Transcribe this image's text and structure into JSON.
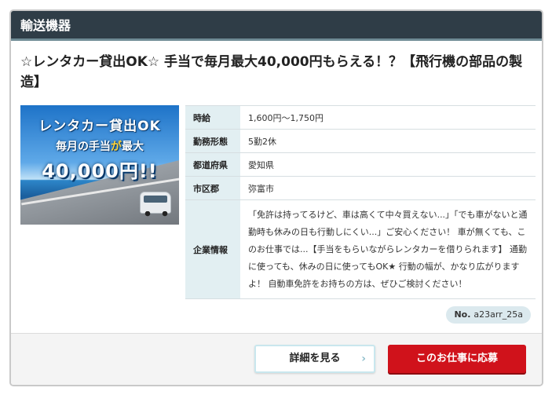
{
  "category": "輸送機器",
  "job": {
    "title": "☆レンタカー貸出OK☆ 手当で毎月最大40,000円もらえる！？【飛行機の部品の製造】",
    "banner": {
      "line1": "レンタカー貸出OK",
      "line2_a": "毎月の手当",
      "line2_b": "が",
      "line2_c": "最大",
      "line3": "40,000円!!"
    },
    "details": [
      {
        "label": "時給",
        "value": "1,600円～1,750円"
      },
      {
        "label": "勤務形態",
        "value": "5勤2休"
      },
      {
        "label": "都道府県",
        "value": "愛知県"
      },
      {
        "label": "市区郡",
        "value": "弥富市"
      },
      {
        "label": "企業情報",
        "value": "「免許は持ってるけど、車は高くて中々買えない...」「でも車がないと通勤時も休みの日も行動しにくい...」ご安心ください！ 車が無くても、このお仕事では...【手当をもらいながらレンタカーを借りられます】 通勤に使っても、休みの日に使ってもOK★ 行動の幅が、かなり広がりますよ！ 自動車免許をお持ちの方は、ぜひご検討ください！"
      }
    ],
    "number_label": "No.",
    "number_value": "a23arr_25a"
  },
  "actions": {
    "detail_label": "詳細を見る",
    "apply_label": "このお仕事に応募"
  }
}
